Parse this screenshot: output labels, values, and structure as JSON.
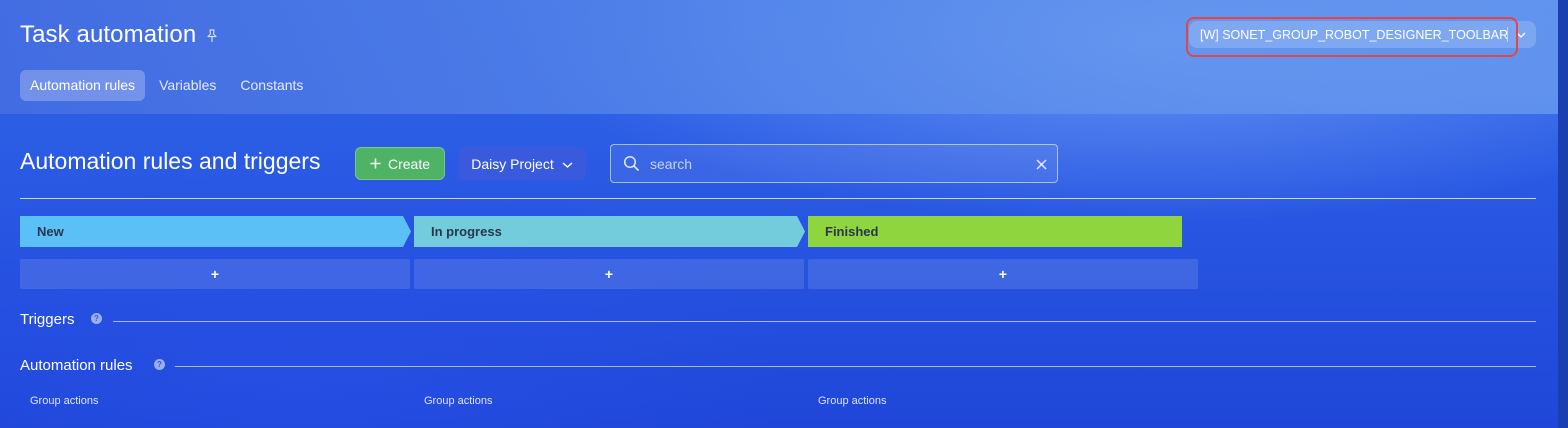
{
  "header": {
    "title": "Task automation",
    "tabs": [
      {
        "label": "Automation rules",
        "active": true
      },
      {
        "label": "Variables",
        "active": false
      },
      {
        "label": "Constants",
        "active": false
      }
    ],
    "toolbar_selector": "[W] SONET_GROUP_ROBOT_DESIGNER_TOOLBAR"
  },
  "main": {
    "section_title": "Automation rules and triggers",
    "create_label": "Create",
    "project_label": "Daisy Project",
    "search_placeholder": "search",
    "stages": [
      {
        "label": "New",
        "color": "#5bc0f5"
      },
      {
        "label": "In progress",
        "color": "#72ccdc"
      },
      {
        "label": "Finished",
        "color": "#8fd63e"
      }
    ],
    "add_symbol": "+",
    "triggers_label": "Triggers",
    "rules_label": "Automation rules",
    "help_symbol": "?",
    "group_actions": [
      "Group actions",
      "Group actions",
      "Group actions"
    ]
  },
  "icons": {
    "pin": "pin-icon",
    "chevron": "chevron-down-icon",
    "search": "search-icon",
    "clear": "close-icon",
    "plus": "plus-icon"
  },
  "colors": {
    "create_button": "#4fb366",
    "highlight_border": "#e04848"
  }
}
